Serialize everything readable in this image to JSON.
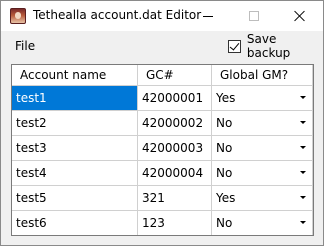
{
  "window": {
    "title": "Tethealla account.dat Editor"
  },
  "menu": {
    "file": "File"
  },
  "options": {
    "save_backup_label": "Save backup",
    "save_backup_checked": true
  },
  "grid": {
    "columns": [
      "Account name",
      "GC#",
      "Global GM?"
    ],
    "rows": [
      {
        "account": "test1",
        "gc": "42000001",
        "gm": "Yes",
        "selected": true
      },
      {
        "account": "test2",
        "gc": "42000002",
        "gm": "No"
      },
      {
        "account": "test3",
        "gc": "42000003",
        "gm": "No"
      },
      {
        "account": "test4",
        "gc": "42000004",
        "gm": "No"
      },
      {
        "account": "test5",
        "gc": "321",
        "gm": "Yes"
      },
      {
        "account": "test6",
        "gc": "123",
        "gm": "No"
      }
    ]
  },
  "colors": {
    "selection": "#0078d7",
    "window_bg": "#f0f0f0"
  }
}
